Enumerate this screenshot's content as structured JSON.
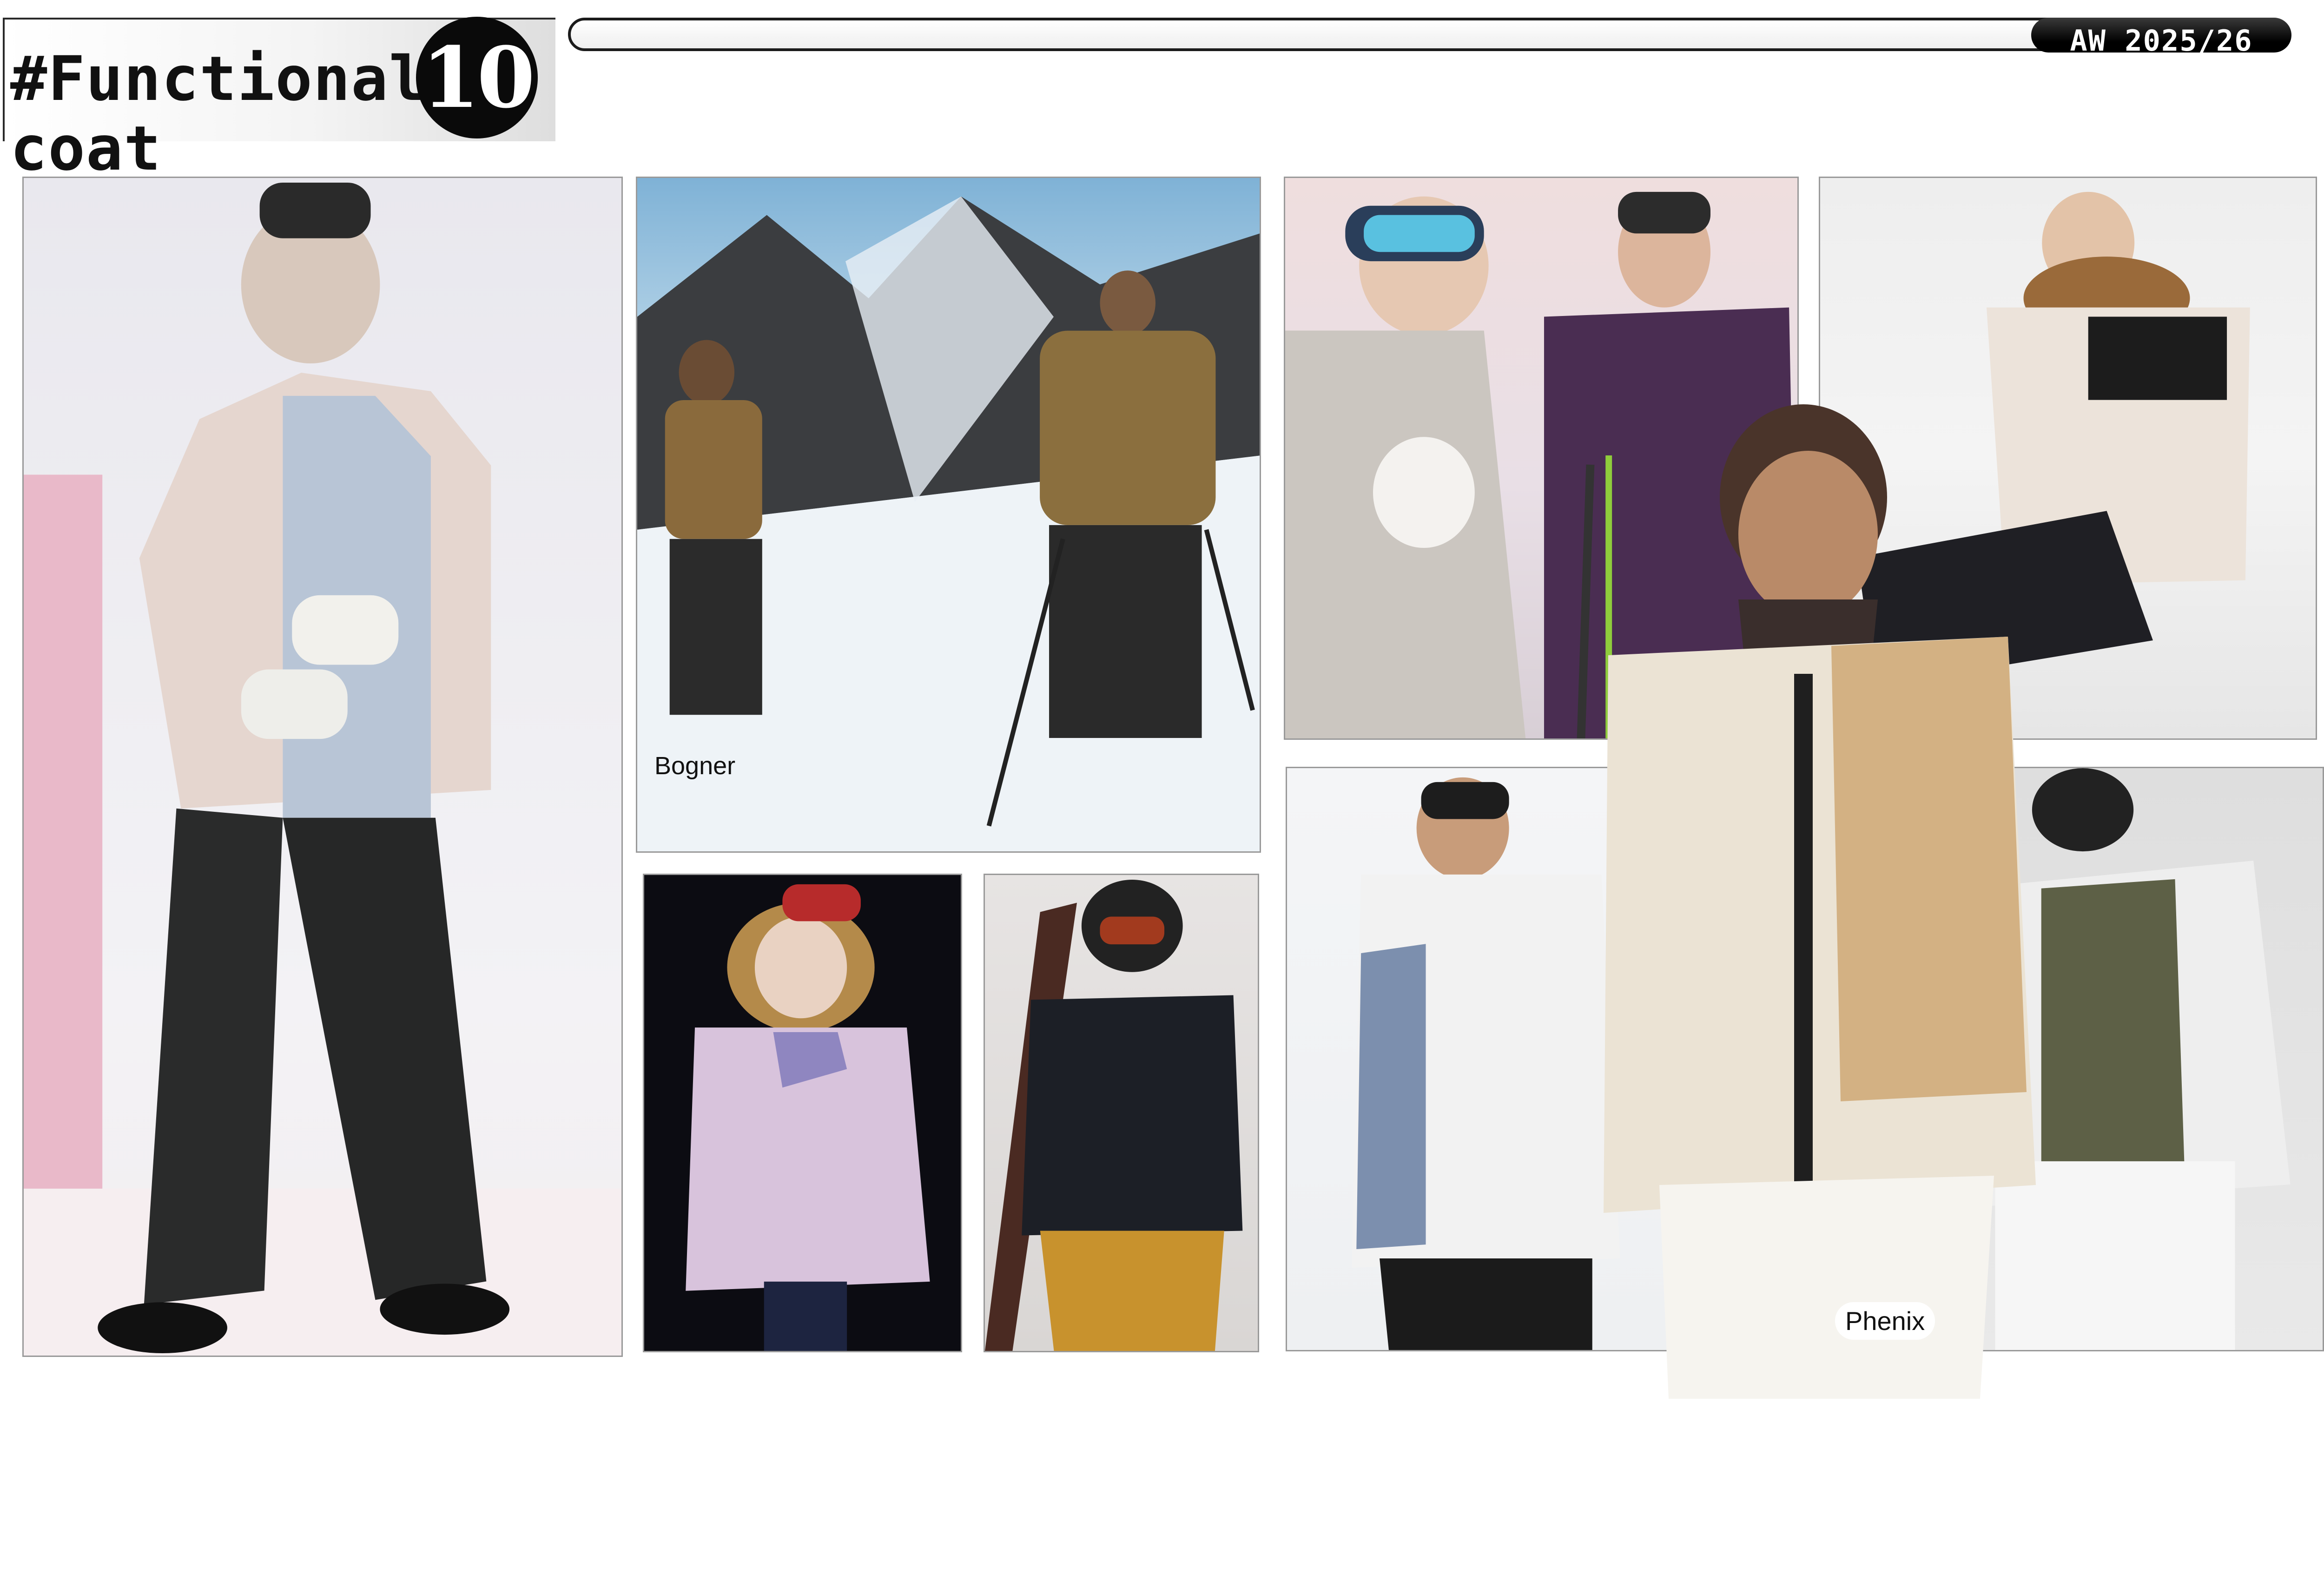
{
  "header": {
    "title_line1": "#Functional",
    "title_line2": "coat",
    "number_badge": "10",
    "season": "AW 2025/26"
  },
  "labels": {
    "bogner": "Bogner",
    "phenix": "Phenix"
  },
  "panels": [
    {
      "id": "p1",
      "subject": "model-pastel-colorblock-jacket-black-pants"
    },
    {
      "id": "p2",
      "subject": "two-skiers-on-snowy-mountain"
    },
    {
      "id": "p3",
      "subject": "model-lilac-down-parka-fur-hood"
    },
    {
      "id": "p4",
      "subject": "skier-black-shell-jacket-holding-skis"
    },
    {
      "id": "p5",
      "subject": "two-skiers-goggles-poles"
    },
    {
      "id": "p6",
      "subject": "model-white-parka-sitting-in-snow"
    },
    {
      "id": "p7",
      "subject": "model-white-grey-blue-shell-jacket"
    },
    {
      "id": "p8",
      "subject": "skier-white-olive-phenix-jacket"
    },
    {
      "id": "cutout",
      "subject": "model-beige-fleece-jacket-white-pants"
    }
  ],
  "colors": {
    "accent_dark": "#0a0a0a",
    "background": "#ffffff"
  }
}
